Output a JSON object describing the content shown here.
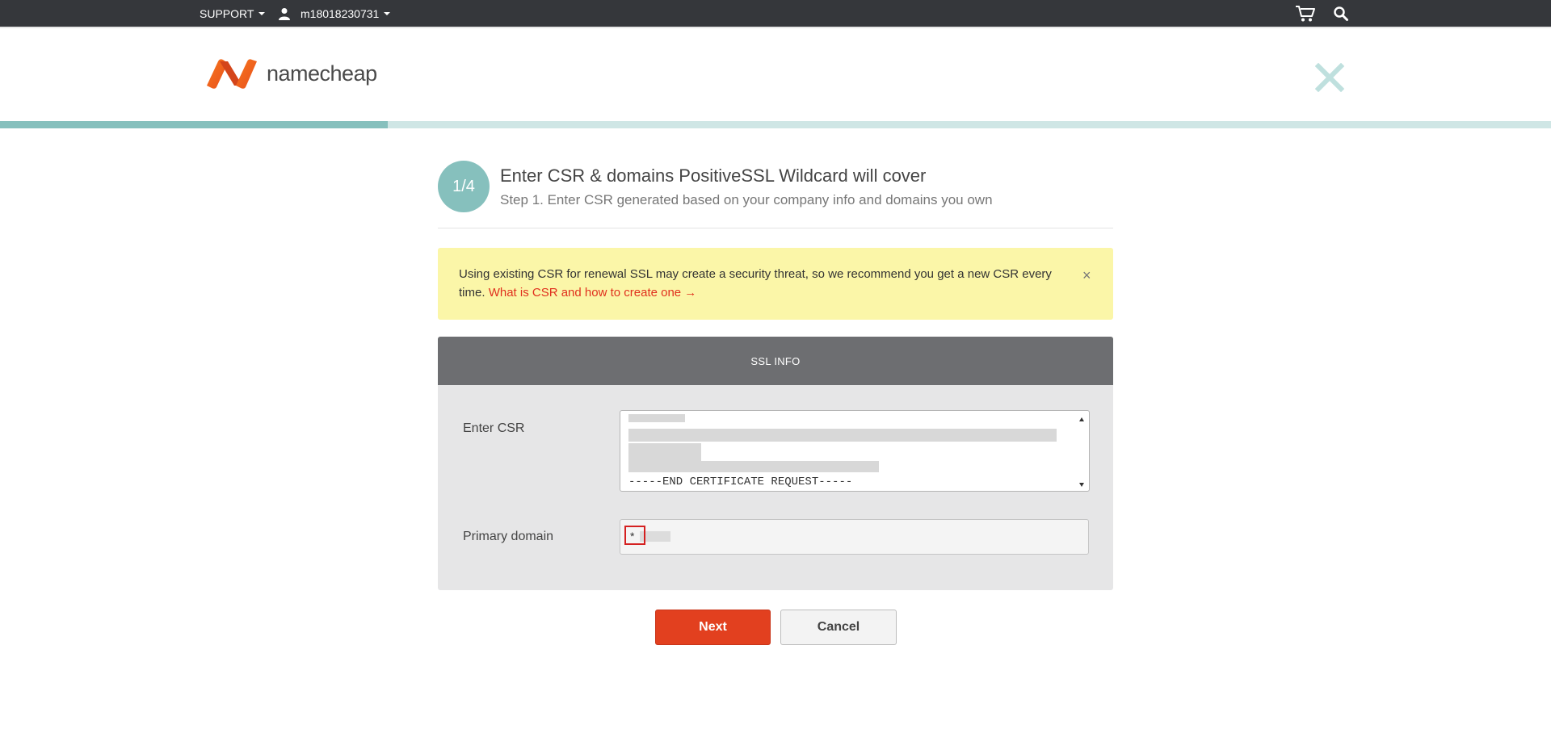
{
  "topbar": {
    "support_label": "SUPPORT",
    "username": "m18018230731",
    "icons": [
      "user-icon",
      "cart-icon",
      "search-icon"
    ]
  },
  "header": {
    "logo_text": "namecheap",
    "close_icon": "close-icon"
  },
  "progress": {
    "fraction": 0.25
  },
  "step": {
    "badge": "1/4",
    "title": "Enter CSR & domains PositiveSSL Wildcard will cover",
    "subtitle": "Step 1. Enter CSR generated based on your company info and domains you own"
  },
  "alert": {
    "text": "Using existing CSR for renewal SSL may create a security threat, so we recommend you get a new CSR every time.",
    "link": "What is CSR and how to create one →",
    "close": "×"
  },
  "panel": {
    "title": "SSL INFO",
    "csr_label": "Enter CSR",
    "csr_end_line": "-----END CERTIFICATE REQUEST-----",
    "domain_label": "Primary domain",
    "domain_value": "*"
  },
  "buttons": {
    "next": "Next",
    "cancel": "Cancel"
  },
  "colors": {
    "accent": "#86c0bd",
    "primary_button": "#e2401f",
    "alert_bg": "#fbf6a8",
    "topbar_bg": "#35373b"
  }
}
